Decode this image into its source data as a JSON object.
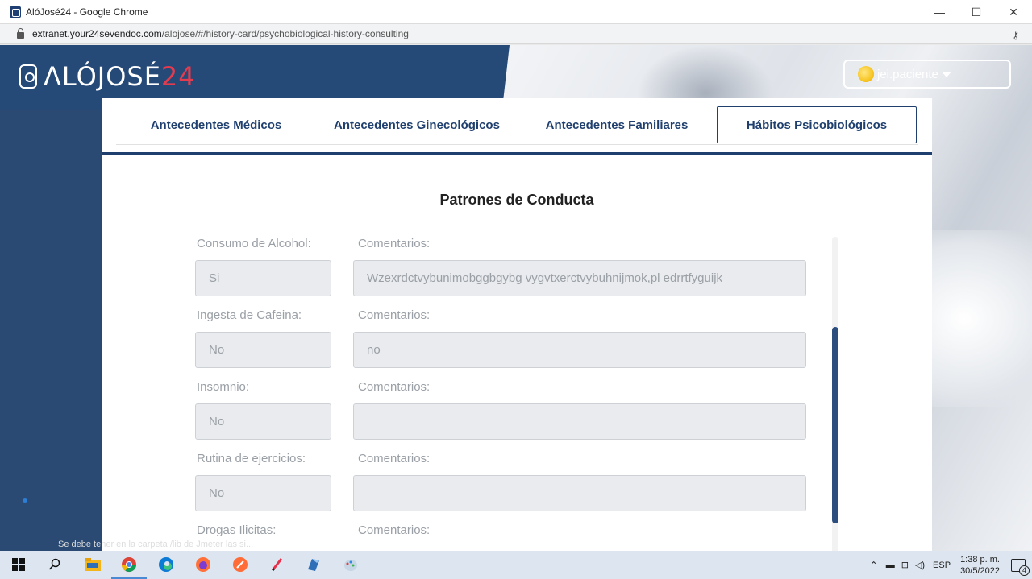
{
  "window": {
    "title": "AlóJosé24 - Google Chrome",
    "minimize": "—",
    "maximize": "☐",
    "close": "✕"
  },
  "address": {
    "host": "extranet.your24sevendoc.com",
    "path": "/alojose/#/history-card/psychobiological-history-consulting"
  },
  "header": {
    "brand_a": "ΛLÓJOSÉ",
    "brand_b": "24",
    "user": "jei.paciente"
  },
  "tabs": [
    {
      "label": "Antecedentes Médicos"
    },
    {
      "label": "Antecedentes Ginecológicos"
    },
    {
      "label": "Antecedentes Familiares"
    },
    {
      "label": "Hábitos Psicobiológicos"
    }
  ],
  "section_title": "Patrones de Conducta",
  "comment_label": "Comentarios:",
  "fields": [
    {
      "label": "Consumo de Alcohol:",
      "value": "Si",
      "comment": "Wzexrdctvybunimobggbgybg vygvtxerctvybuhnijmok,pl edrrtfyguijk"
    },
    {
      "label": "Ingesta de Cafeina:",
      "value": "No",
      "comment": "no"
    },
    {
      "label": "Insomnio:",
      "value": "No",
      "comment": ""
    },
    {
      "label": "Rutina de ejercicios:",
      "value": "No",
      "comment": ""
    },
    {
      "label": "Drogas Ilicitas:",
      "value": "",
      "comment": ""
    }
  ],
  "notification_text": "Se debe tener en la carpeta /lib de Jmeter las si...",
  "taskbar": {
    "lang": "ESP",
    "time": "1:38 p. m.",
    "date": "30/5/2022",
    "notif_count": "4"
  }
}
